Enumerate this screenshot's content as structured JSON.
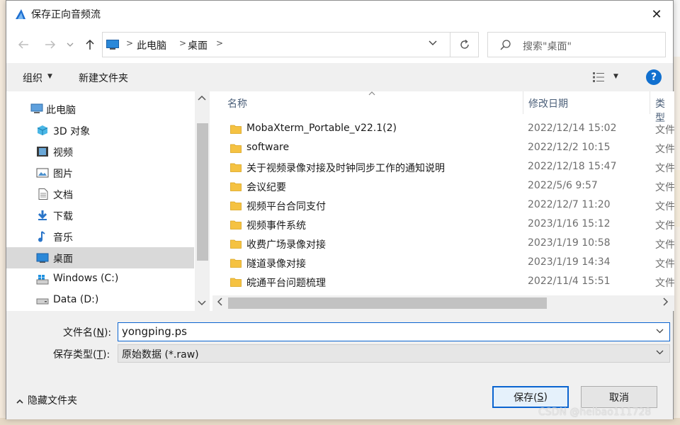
{
  "window": {
    "title": "保存正向音频流",
    "close_symbol": "✕"
  },
  "address": {
    "crumbs": [
      "此电脑",
      "桌面"
    ],
    "search_placeholder": "搜索\"桌面\""
  },
  "toolbar": {
    "organize_label": "组织",
    "new_folder_label": "新建文件夹",
    "help_label": "?"
  },
  "nav": {
    "items": [
      {
        "label": "此电脑",
        "icon": "computer-icon",
        "selected": false
      },
      {
        "label": "3D 对象",
        "icon": "cube-3d-icon",
        "selected": false
      },
      {
        "label": "视频",
        "icon": "video-icon",
        "selected": false
      },
      {
        "label": "图片",
        "icon": "picture-icon",
        "selected": false
      },
      {
        "label": "文档",
        "icon": "document-icon",
        "selected": false
      },
      {
        "label": "下载",
        "icon": "download-icon",
        "selected": false
      },
      {
        "label": "音乐",
        "icon": "music-icon",
        "selected": false
      },
      {
        "label": "桌面",
        "icon": "desktop-icon",
        "selected": true
      },
      {
        "label": "Windows (C:)",
        "icon": "windows-drive-icon",
        "selected": false
      },
      {
        "label": "Data (D:)",
        "icon": "drive-icon",
        "selected": false
      }
    ]
  },
  "files": {
    "columns": {
      "name": "名称",
      "date": "修改日期",
      "type": "类型"
    },
    "rows": [
      {
        "name": "MobaXterm_Portable_v22.1(2)",
        "date": "2022/12/14 15:02",
        "type": "文件"
      },
      {
        "name": "software",
        "date": "2022/12/2 10:15",
        "type": "文件"
      },
      {
        "name": "关于视频录像对接及时钟同步工作的通知说明",
        "date": "2022/12/18 15:47",
        "type": "文件"
      },
      {
        "name": "会议纪要",
        "date": "2022/5/6 9:57",
        "type": "文件"
      },
      {
        "name": "视频平台合同支付",
        "date": "2022/12/7 11:20",
        "type": "文件"
      },
      {
        "name": "视频事件系统",
        "date": "2023/1/16 15:12",
        "type": "文件"
      },
      {
        "name": "收费广场录像对接",
        "date": "2023/1/19 10:58",
        "type": "文件"
      },
      {
        "name": "隧道录像对接",
        "date": "2023/1/19 14:34",
        "type": "文件"
      },
      {
        "name": "皖通平台问题梳理",
        "date": "2022/11/4 15:51",
        "type": "文件"
      }
    ]
  },
  "form": {
    "filename_label": "文件名(",
    "filename_key": "N",
    "filename_label_end": "):",
    "filename_value": "yongping.ps",
    "filetype_label": "保存类型(",
    "filetype_key": "T",
    "filetype_label_end": "):",
    "filetype_value": "原始数据 (*.raw)"
  },
  "footer": {
    "hide_folders_label": "隐藏文件夹",
    "save_label": "保存(",
    "save_key": "S",
    "save_label_end": ")",
    "cancel_label": "取消"
  },
  "watermark": "CSDN @heibao111728",
  "colors": {
    "accent": "#0a64d0",
    "selected_bg": "#d9d9d9",
    "folder": "#f5c242"
  }
}
